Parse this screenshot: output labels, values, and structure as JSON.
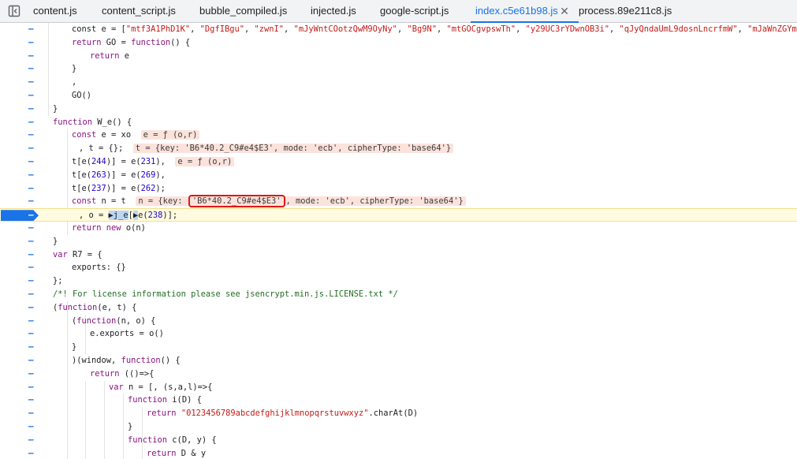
{
  "tabs": [
    {
      "label": "content.js",
      "active": false
    },
    {
      "label": "content_script.js",
      "active": false
    },
    {
      "label": "bubble_compiled.js",
      "active": false
    },
    {
      "label": "injected.js",
      "active": false
    },
    {
      "label": "google-script.js",
      "active": false
    },
    {
      "label": "index.c5e61b98.js",
      "active": true
    },
    {
      "label": "process.89e211c8.js",
      "active": false
    }
  ],
  "close_glyph": "✕",
  "gutter_marker": "–",
  "lines": [
    [
      [
        "t",
        "const e = ["
      ],
      [
        "s",
        "\"mtf3A1PhD1K\""
      ],
      [
        "t",
        ", "
      ],
      [
        "s",
        "\"DgfIBgu\""
      ],
      [
        "t",
        ", "
      ],
      [
        "s",
        "\"zwnI\""
      ],
      [
        "t",
        ", "
      ],
      [
        "s",
        "\"mJyWntCOotzQwM9OyNy\""
      ],
      [
        "t",
        ", "
      ],
      [
        "s",
        "\"Bg9N\""
      ],
      [
        "t",
        ", "
      ],
      [
        "s",
        "\"mtGOCgvpswTh\""
      ],
      [
        "t",
        ", "
      ],
      [
        "s",
        "\"y29UC3rYDwnOB3i\""
      ],
      [
        "t",
        ", "
      ],
      [
        "s",
        "\"qJyQndaUmL9dosnLncrfmW\""
      ],
      [
        "t",
        ", "
      ],
      [
        "s",
        "\"mJaWnZGYmNbYtgTc"
      ]
    ],
    [
      [
        "k",
        "return"
      ],
      [
        "t",
        " GO = "
      ],
      [
        "k",
        "function"
      ],
      [
        "t",
        "() {"
      ]
    ],
    [
      [
        "k",
        "return"
      ],
      [
        "t",
        " e"
      ]
    ],
    [
      [
        "t",
        "}"
      ]
    ],
    [
      [
        "t",
        ","
      ]
    ],
    [
      [
        "t",
        "GO()"
      ]
    ],
    [
      [
        "t",
        "}"
      ]
    ],
    [
      [
        "k",
        "function"
      ],
      [
        "t",
        " W_e() {"
      ]
    ],
    [
      [
        "k",
        "const"
      ],
      [
        "t",
        " e = xo  "
      ],
      [
        "v",
        "e = ƒ (o,r)"
      ]
    ],
    [
      [
        "t",
        ", t = {};  "
      ],
      [
        "v",
        "t = {key: 'B6*40.2_C9#e4$E3', mode: 'ecb', cipherType: 'base64'}"
      ]
    ],
    [
      [
        "t",
        "t[e("
      ],
      [
        "n",
        "244"
      ],
      [
        "t",
        ")] = e("
      ],
      [
        "n",
        "231"
      ],
      [
        "t",
        "),  "
      ],
      [
        "v",
        "e = ƒ (o,r)"
      ]
    ],
    [
      [
        "t",
        "t[e("
      ],
      [
        "n",
        "263"
      ],
      [
        "t",
        ")] = e("
      ],
      [
        "n",
        "269"
      ],
      [
        "t",
        "),"
      ]
    ],
    [
      [
        "t",
        "t[e("
      ],
      [
        "n",
        "237"
      ],
      [
        "t",
        ")] = e("
      ],
      [
        "n",
        "262"
      ],
      [
        "t",
        ");"
      ]
    ],
    [
      [
        "k",
        "const"
      ],
      [
        "t",
        " n = t  "
      ],
      [
        "v",
        "n = {key: "
      ],
      [
        "r",
        "'B6*40.2_C9#e4$E3'"
      ],
      [
        "v",
        ", mode: 'ecb', cipherType: 'base64'}"
      ]
    ],
    [
      [
        "t",
        ", o = "
      ],
      [
        "h",
        "▶j_e"
      ],
      [
        "t",
        "["
      ],
      [
        "h",
        "▶"
      ],
      [
        "t",
        "e("
      ],
      [
        "n",
        "238"
      ],
      [
        "t",
        ")];"
      ]
    ],
    [
      [
        "k",
        "return new"
      ],
      [
        "t",
        " o(n)"
      ]
    ],
    [
      [
        "t",
        "}"
      ]
    ],
    [
      [
        "k",
        "var"
      ],
      [
        "t",
        " R7 = {"
      ]
    ],
    [
      [
        "t",
        "exports: {}"
      ]
    ],
    [
      [
        "t",
        "};"
      ]
    ],
    [
      [
        "c",
        "/*! For license information please see jsencrypt.min.js.LICENSE.txt */"
      ]
    ],
    [
      [
        "t",
        "("
      ],
      [
        "k",
        "function"
      ],
      [
        "t",
        "(e, t) {"
      ]
    ],
    [
      [
        "t",
        "("
      ],
      [
        "k",
        "function"
      ],
      [
        "t",
        "(n, o) {"
      ]
    ],
    [
      [
        "t",
        "e.exports = o()"
      ]
    ],
    [
      [
        "t",
        "}"
      ]
    ],
    [
      [
        "t",
        ")(window, "
      ],
      [
        "k",
        "function"
      ],
      [
        "t",
        "() {"
      ]
    ],
    [
      [
        "k",
        "return"
      ],
      [
        "t",
        " (()=>{"
      ]
    ],
    [
      [
        "k",
        "var"
      ],
      [
        "t",
        " n = [, (s,a,l)=>{"
      ]
    ],
    [
      [
        "k",
        "function"
      ],
      [
        "t",
        " i(D) {"
      ]
    ],
    [
      [
        "k",
        "return"
      ],
      [
        "t",
        " "
      ],
      [
        "s",
        "\"0123456789abcdefghijklmnopqrstuvwxyz\""
      ],
      [
        "t",
        ".charAt(D)"
      ]
    ],
    [
      [
        "t",
        "}"
      ]
    ],
    [
      [
        "k",
        "function"
      ],
      [
        "t",
        " c(D, y) {"
      ]
    ],
    [
      [
        "k",
        "return"
      ],
      [
        "t",
        " D & y"
      ]
    ]
  ]
}
